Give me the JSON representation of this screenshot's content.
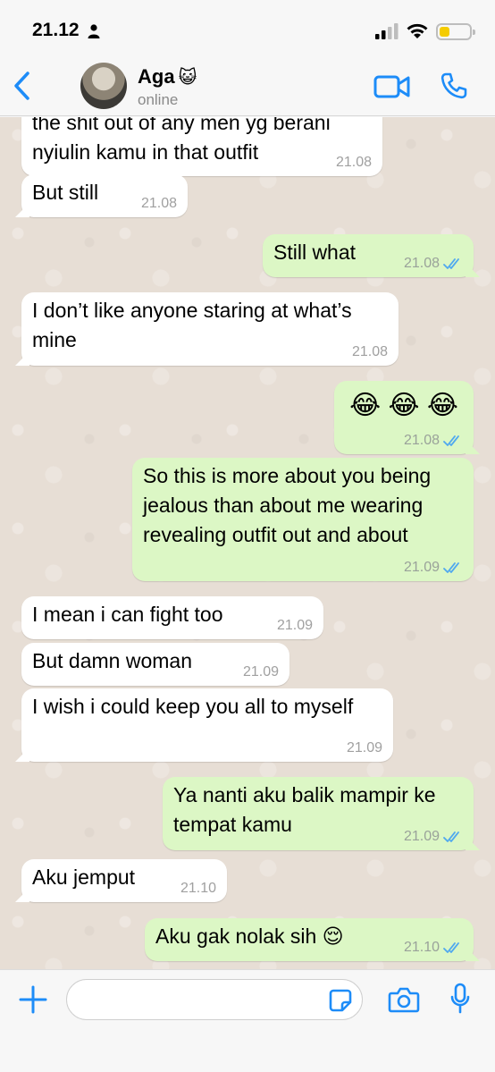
{
  "status_bar": {
    "time": "21.12",
    "battery_level": 0.35,
    "battery_color": "#f5cc00"
  },
  "header": {
    "contact_name": "Aga",
    "contact_emoji": "😺",
    "contact_status": "online",
    "accent_color": "#1d8cf8",
    "icons": [
      "back-chevron-icon",
      "video-call-icon",
      "phone-icon"
    ]
  },
  "messages": [
    {
      "direction": "in",
      "text": "the shit out of any men yg berani\nnyiulin kamu in that outfit",
      "time": "21.08"
    },
    {
      "direction": "in",
      "text": "But still",
      "time": "21.08"
    },
    {
      "direction": "out",
      "text": "Still what",
      "time": "21.08",
      "status": "read"
    },
    {
      "direction": "in",
      "text": "I don’t like anyone staring at what’s\nmine",
      "time": "21.08"
    },
    {
      "direction": "out",
      "text": "😂 😂 😂",
      "time": "21.08",
      "status": "read"
    },
    {
      "direction": "out",
      "text": "So this is more about you being\njealous than about me wearing\nrevealing outfit out and about",
      "time": "21.09",
      "status": "read"
    },
    {
      "direction": "in",
      "text": "I mean i can fight too",
      "time": "21.09"
    },
    {
      "direction": "in",
      "text": "But damn woman",
      "time": "21.09"
    },
    {
      "direction": "in",
      "text": "I wish i could keep you all to myself",
      "time": "21.09"
    },
    {
      "direction": "out",
      "text": "Ya nanti aku balik mampir ke\ntempat kamu",
      "time": "21.09",
      "status": "read"
    },
    {
      "direction": "in",
      "text": "Aku jemput",
      "time": "21.10"
    },
    {
      "direction": "out",
      "text": "Aku gak nolak sih 😌",
      "time": "21.10",
      "status": "read"
    }
  ],
  "input_bar": {
    "placeholder": "",
    "icons": [
      "plus-icon",
      "sticker-icon",
      "camera-icon",
      "microphone-icon"
    ]
  },
  "colors": {
    "incoming_bubble": "#ffffff",
    "outgoing_bubble": "#dcf7c5",
    "read_tick": "#4fa8ef",
    "chat_background": "#e7ded5"
  }
}
